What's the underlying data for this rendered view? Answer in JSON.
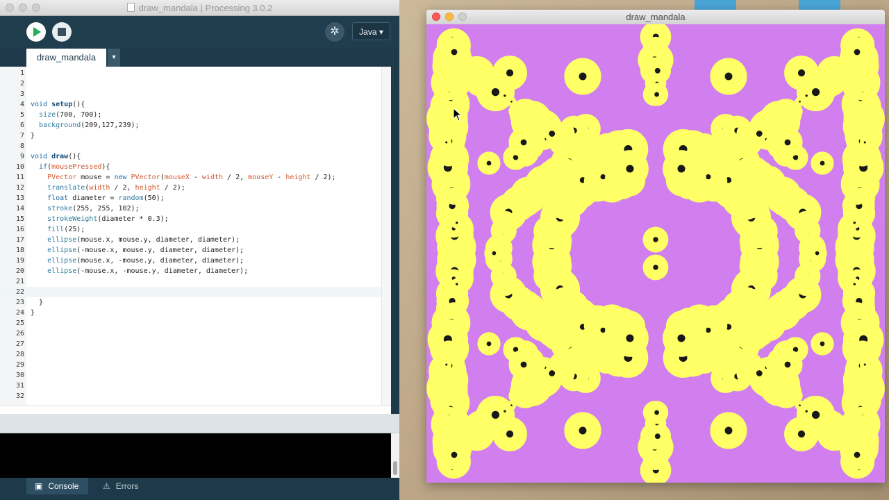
{
  "ide": {
    "window_title": "draw_mandala | Processing 3.0.2",
    "mode_label": "Java ▾",
    "debug_icon": "butterfly-debug-icon",
    "tab_label": "draw_mandala",
    "tab_menu_glyph": "▾",
    "console_tab": "Console",
    "errors_tab": "Errors",
    "current_line": 22
  },
  "code_lines": [
    {
      "n": "1",
      "html": ""
    },
    {
      "n": "2",
      "html": ""
    },
    {
      "n": "3",
      "html": ""
    },
    {
      "n": "4",
      "html": "<span class='kw'>void</span> <span class='fn'>setup</span>(){"
    },
    {
      "n": "5",
      "html": "  <span class='bi'>size</span>(700, 700);"
    },
    {
      "n": "6",
      "html": "  <span class='bi'>background</span>(209,127,239);"
    },
    {
      "n": "7",
      "html": "}"
    },
    {
      "n": "8",
      "html": ""
    },
    {
      "n": "9",
      "html": "<span class='kw'>void</span> <span class='fn'>draw</span>(){"
    },
    {
      "n": "10",
      "html": "  <span class='kw'>if</span>(<span class='ty'>mousePressed</span>){"
    },
    {
      "n": "11",
      "html": "    <span class='ty'>PVector</span> mouse = <span class='kw'>new</span> <span class='ty'>PVector</span>(<span class='ty'>mouseX</span> - <span class='ty'>width</span> / 2, <span class='ty'>mouseY</span> - <span class='ty'>height</span> / 2);"
    },
    {
      "n": "12",
      "html": "    <span class='bi'>translate</span>(<span class='ty'>width</span> / 2, <span class='ty'>height</span> / 2);"
    },
    {
      "n": "13",
      "html": "    <span class='kw'>float</span> diameter = <span class='bi'>random</span>(50);"
    },
    {
      "n": "14",
      "html": "    <span class='bi'>stroke</span>(255, 255, 102);"
    },
    {
      "n": "15",
      "html": "    <span class='bi'>strokeWeight</span>(diameter * 0.3);"
    },
    {
      "n": "16",
      "html": "    <span class='bi'>fill</span>(25);"
    },
    {
      "n": "17",
      "html": "    <span class='bi'>ellipse</span>(mouse.x, mouse.y, diameter, diameter);"
    },
    {
      "n": "18",
      "html": "    <span class='bi'>ellipse</span>(-mouse.x, mouse.y, diameter, diameter);"
    },
    {
      "n": "19",
      "html": "    <span class='bi'>ellipse</span>(mouse.x, -mouse.y, diameter, diameter);"
    },
    {
      "n": "20",
      "html": "    <span class='bi'>ellipse</span>(-mouse.x, -mouse.y, diameter, diameter);"
    },
    {
      "n": "21",
      "html": ""
    },
    {
      "n": "22",
      "html": ""
    },
    {
      "n": "23",
      "html": "  }"
    },
    {
      "n": "24",
      "html": "}"
    },
    {
      "n": "25",
      "html": ""
    },
    {
      "n": "26",
      "html": ""
    },
    {
      "n": "27",
      "html": ""
    },
    {
      "n": "28",
      "html": ""
    },
    {
      "n": "29",
      "html": ""
    },
    {
      "n": "30",
      "html": ""
    },
    {
      "n": "31",
      "html": ""
    },
    {
      "n": "32",
      "html": ""
    }
  ],
  "sketch": {
    "window_title": "draw_mandala",
    "background_color": "#d17fef",
    "stroke_color": "#ffff66",
    "fill_color": "#191919"
  }
}
